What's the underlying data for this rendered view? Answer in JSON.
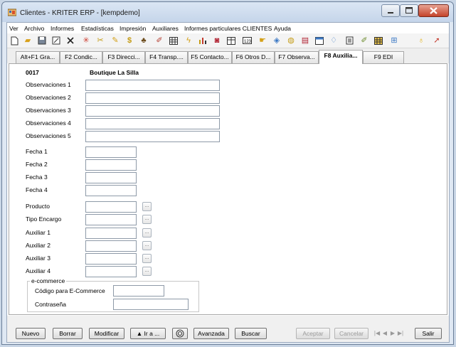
{
  "window": {
    "title": "Clientes - KRITER ERP - [kempdemo]"
  },
  "menu": [
    "Ver",
    "Archivo",
    "Informes",
    "Estadísticas",
    "Impresión",
    "Auxiliares",
    "Informes particulares CLIENTES",
    "Ayuda"
  ],
  "toolbar_icons": [
    "new-document-icon",
    "open-folder-icon",
    "save-disk-icon",
    "edit-document-icon",
    "delete-x-icon",
    "multi-color-icon",
    "scissors-icon",
    "pencil-icon",
    "dollar-icon",
    "stamp-icon",
    "wrench-icon",
    "grid-icon",
    "lightning-icon",
    "bar-chart-icon",
    "camera-icon",
    "table-icon",
    "keyboard-icon",
    "hand-icon",
    "chart-icon",
    "globe-icon",
    "calculator-icon",
    "calendar-icon",
    "tag-icon",
    "document-icon",
    "paperclip-icon",
    "table-2-icon",
    "network-icon",
    "lightbulb-icon",
    "exit-icon"
  ],
  "tabs": [
    {
      "label": "Alt+F1 Gra..."
    },
    {
      "label": "F2 Condic..."
    },
    {
      "label": "F3 Direcci..."
    },
    {
      "label": "F4 Transp...."
    },
    {
      "label": "F5 Contacto..."
    },
    {
      "label": "F6 Otros D..."
    },
    {
      "label": "F7 Observa..."
    },
    {
      "label": "F8 Auxilia..."
    },
    {
      "label": "F9 EDI"
    }
  ],
  "active_tab": "F8 Auxilia...",
  "client": {
    "code": "0017",
    "name": "Boutique La Silla"
  },
  "labels": {
    "obs1": "Observaciones 1",
    "obs2": "Observaciones 2",
    "obs3": "Observaciones 3",
    "obs4": "Observaciones 4",
    "obs5": "Observaciones 5",
    "fecha1": "Fecha 1",
    "fecha2": "Fecha 2",
    "fecha3": "Fecha 3",
    "fecha4": "Fecha 4",
    "producto": "Producto",
    "tipo_encargo": "Tipo Encargo",
    "aux1": "Auxiliar 1",
    "aux2": "Auxiliar 2",
    "aux3": "Auxiliar 3",
    "aux4": "Auxiliar 4"
  },
  "values": {
    "obs1": "",
    "obs2": "",
    "obs3": "",
    "obs4": "",
    "obs5": "",
    "fecha1": "",
    "fecha2": "",
    "fecha3": "",
    "fecha4": "",
    "producto": "",
    "tipo_encargo": "",
    "aux1": "",
    "aux2": "",
    "aux3": "",
    "aux4": ""
  },
  "ellipsis": "...",
  "ecommerce": {
    "title": "e-commerce",
    "code_label": "Código para E-Commerce",
    "password_label": "Contraseña",
    "code_value": "",
    "password_value": ""
  },
  "buttons": {
    "nuevo": "Nuevo",
    "borrar": "Borrar",
    "modificar": "Modificar",
    "ira": "▲ Ir a ...",
    "avanzada": "Avanzada",
    "buscar": "Buscar",
    "aceptar": "Aceptar",
    "cancelar": "Cancelar",
    "salir": "Salir"
  },
  "nav": [
    "|◀",
    "◀",
    "▶",
    "▶|"
  ]
}
